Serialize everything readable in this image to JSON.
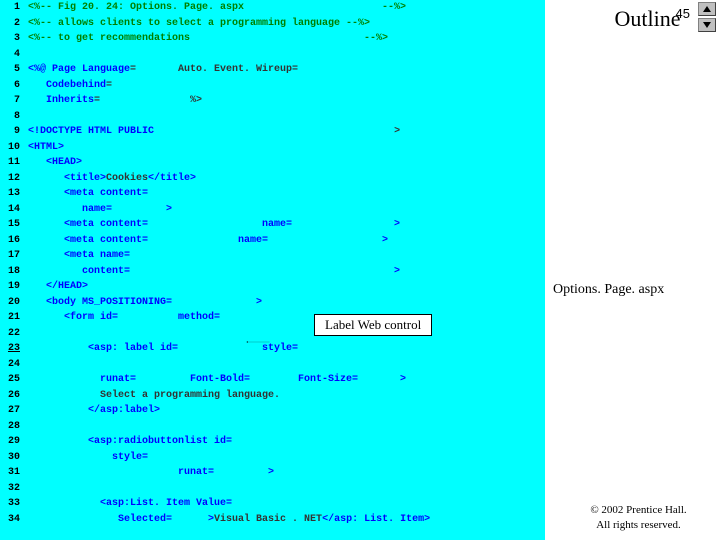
{
  "page_number": "45",
  "outline_title": "Outline",
  "file_label": "Options. Page. aspx",
  "copyright_line1": "© 2002 Prentice Hall.",
  "copyright_line2": "All rights reserved.",
  "callout_text": "Label Web control",
  "line_numbers": [
    "1",
    "2",
    "3",
    "4",
    "5",
    "6",
    "7",
    "8",
    "9",
    "10",
    "11",
    "12",
    "13",
    "14",
    "15",
    "16",
    "17",
    "18",
    "19",
    "20",
    "21",
    "22",
    "23",
    "24",
    "25",
    "26",
    "27",
    "28",
    "29",
    "30",
    "31",
    "32",
    "33",
    "34"
  ],
  "code": {
    "l1": "<%-- Fig 20. 24: Options. Page. aspx                       --%>",
    "l2": "<%-- allows clients to select a programming language --%>",
    "l3": "<%-- to get recommendations                             --%>",
    "l5a": "<%@ Page Language",
    "l5b": "=       Auto. Event. Wireup=",
    "l6a": "   Codebehind",
    "l6b": "=",
    "l7a": "   Inherits",
    "l7b": "=               %>",
    "l9a": "<!DOCTYPE HTML PUBLIC",
    "l9b": "                                        >",
    "l10": "<HTML>",
    "l11": "   <HEAD>",
    "l12a": "      <title>",
    "l12b": "Cookies",
    "l12c": "</title>",
    "l13": "      <meta content=",
    "l14": "         name=         >",
    "l15": "      <meta content=                   name=                 >",
    "l16": "      <meta content=               name=                   >",
    "l17": "      <meta name=",
    "l18": "         content=                                            >",
    "l19": "   </HEAD>",
    "l20": "   <body MS_POSITIONING=              >",
    "l21": "      <form id=          method=",
    "l23": "          <asp: label id=              style=",
    "l25": "            runat=         Font-Bold=        Font-Size=       >",
    "l26": "            Select a programming language.",
    "l27": "          </asp:label>",
    "l29": "          <asp:radiobuttonlist id=",
    "l30": "              style=",
    "l31": "                         runat=         >",
    "l33": "            <asp:List. Item Value=",
    "l34a": "               Selected=      >",
    "l34b": "Visual Basic . NET",
    "l34c": "</asp: List. Item>"
  }
}
